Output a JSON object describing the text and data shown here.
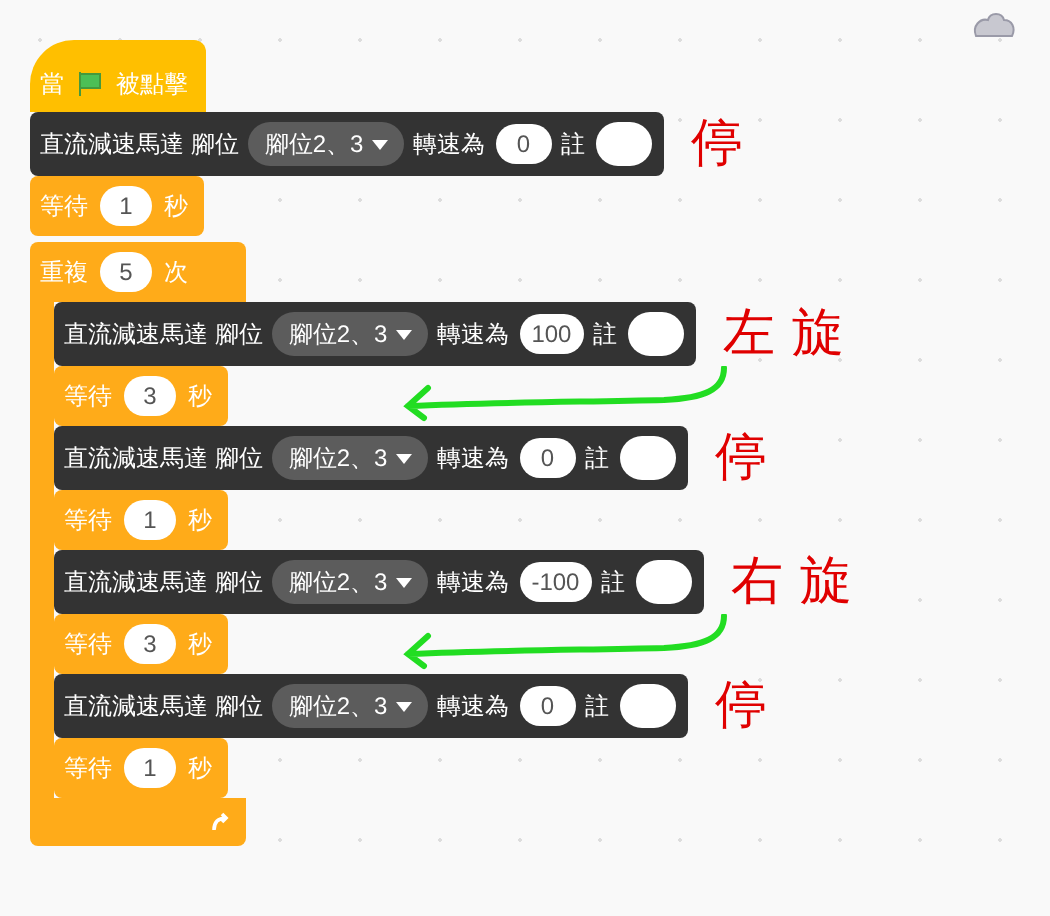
{
  "hat": {
    "before": "當",
    "after": "被點擊"
  },
  "script": [
    {
      "kind": "motor",
      "label": "直流減速馬達 腳位",
      "pin": "腳位2、3",
      "speed_label": "轉速為",
      "speed": "0",
      "note_label": "註",
      "annotation": "停"
    },
    {
      "kind": "wait",
      "before": "等待",
      "value": "1",
      "after": "秒",
      "arrow": false
    },
    {
      "kind": "repeat",
      "before": "重複",
      "value": "5",
      "after": "次",
      "children": [
        {
          "kind": "motor",
          "label": "直流減速馬達 腳位",
          "pin": "腳位2、3",
          "speed_label": "轉速為",
          "speed": "100",
          "note_label": "註",
          "annotation": "左 旋"
        },
        {
          "kind": "wait",
          "before": "等待",
          "value": "3",
          "after": "秒",
          "arrow": true
        },
        {
          "kind": "motor",
          "label": "直流減速馬達 腳位",
          "pin": "腳位2、3",
          "speed_label": "轉速為",
          "speed": "0",
          "note_label": "註",
          "annotation": "停"
        },
        {
          "kind": "wait",
          "before": "等待",
          "value": "1",
          "after": "秒",
          "arrow": false
        },
        {
          "kind": "motor",
          "label": "直流減速馬達 腳位",
          "pin": "腳位2、3",
          "speed_label": "轉速為",
          "speed": "-100",
          "note_label": "註",
          "annotation": "右 旋"
        },
        {
          "kind": "wait",
          "before": "等待",
          "value": "3",
          "after": "秒",
          "arrow": true
        },
        {
          "kind": "motor",
          "label": "直流減速馬達 腳位",
          "pin": "腳位2、3",
          "speed_label": "轉速為",
          "speed": "0",
          "note_label": "註",
          "annotation": "停"
        },
        {
          "kind": "wait",
          "before": "等待",
          "value": "1",
          "after": "秒",
          "arrow": false
        }
      ]
    }
  ]
}
